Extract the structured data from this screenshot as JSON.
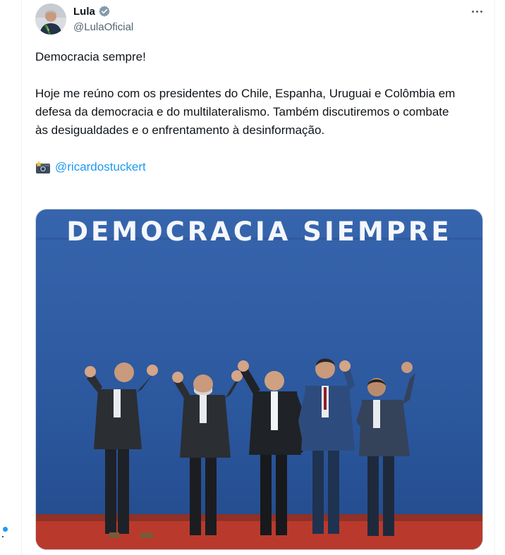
{
  "tweet": {
    "author_name": "Lula",
    "author_handle": "@LulaOficial",
    "paragraphs": [
      "Democracia sempre!",
      "Hoje me reúno com os presidentes do Chile, Espanha, Uruguai e Colômbia em defesa da democracia e do multilateralismo. Também discutiremos o combate às desigualdades e o enfrentamento à desinformação."
    ],
    "photo_credit_mention": "@ricardostuckert",
    "image_banner_text": "DEMOCRACIA SIEMPRE"
  },
  "icons": {
    "verified": "verified-badge-icon",
    "more": "more-options-icon",
    "camera": "camera-flash-icon"
  },
  "colors": {
    "link": "#1d9bf0",
    "text": "#0f1419",
    "secondary": "#536471",
    "banner_blue": "#2f5da5",
    "carpet_red": "#b93a2c"
  }
}
